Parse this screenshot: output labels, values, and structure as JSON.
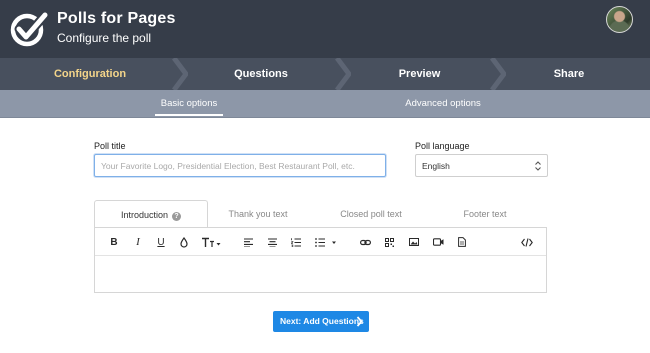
{
  "header": {
    "title": "Polls for Pages",
    "subtitle": "Configure the poll"
  },
  "steps": [
    {
      "label": "Configuration",
      "active": true
    },
    {
      "label": "Questions",
      "active": false
    },
    {
      "label": "Preview",
      "active": false
    },
    {
      "label": "Share",
      "active": false
    }
  ],
  "subtabs": [
    {
      "label": "Basic options",
      "active": true
    },
    {
      "label": "Advanced options",
      "active": false
    }
  ],
  "form": {
    "poll_title_label": "Poll title",
    "poll_title_value": "",
    "poll_title_placeholder": "Your Favorite Logo, Presidential Election, Best Restaurant Poll, etc.",
    "poll_language_label": "Poll language",
    "poll_language_value": "English"
  },
  "content_tabs": [
    {
      "label": "Introduction",
      "active": true,
      "help": "?"
    },
    {
      "label": "Thank you text",
      "active": false
    },
    {
      "label": "Closed poll text",
      "active": false
    },
    {
      "label": "Footer text",
      "active": false
    }
  ],
  "toolbar": {
    "bold": "B",
    "italic": "I",
    "underline": "U"
  },
  "next_button": {
    "label": "Next: Add Questions"
  },
  "colors": {
    "header_bg": "#363d49",
    "steps_bg": "#48505e",
    "active_step": "#f4d58a",
    "subtabs_bg": "#8d97a8",
    "primary_button": "#1e88e5"
  },
  "icons": [
    "check-logo-icon",
    "user-avatar",
    "step-chevron-icon",
    "help-icon",
    "font-color-icon",
    "font-size-icon",
    "align-left-icon",
    "align-center-icon",
    "ordered-list-icon",
    "unordered-list-icon",
    "link-icon",
    "qr-code-icon",
    "image-icon",
    "video-icon",
    "file-icon",
    "code-view-icon",
    "select-arrows-icon",
    "chevron-right-icon"
  ]
}
